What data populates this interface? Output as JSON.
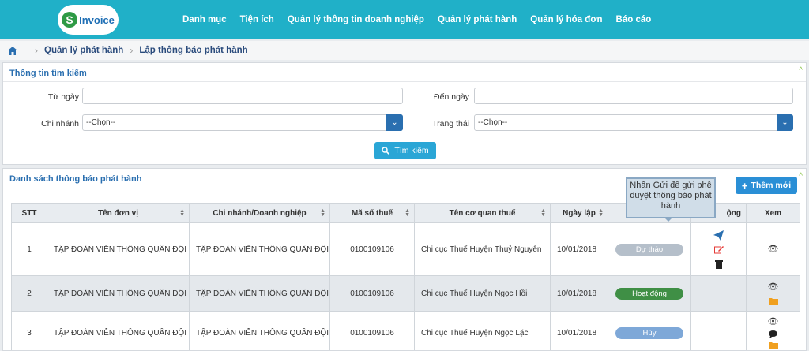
{
  "header": {
    "logo_text": "Invoice",
    "logo_letter": "S",
    "menu": [
      "Danh mục",
      "Tiện ích",
      "Quản lý thông tin doanh nghiệp",
      "Quản lý phát hành",
      "Quản lý hóa đơn",
      "Báo cáo"
    ]
  },
  "breadcrumb": {
    "items": [
      "Quản lý phát hành",
      "Lập thông báo phát hành"
    ]
  },
  "search": {
    "title": "Thông tin tìm kiếm",
    "from_date_label": "Từ ngày",
    "to_date_label": "Đến ngày",
    "branch_label": "Chi nhánh",
    "branch_value": "--Chọn--",
    "status_label": "Trạng thái",
    "status_value": "--Chọn--",
    "search_button": "Tìm kiếm"
  },
  "list": {
    "title": "Danh sách thông báo phát hành",
    "add_button": "Thêm mới",
    "tooltip": "Nhấn Gửi để gửi phê duyệt thông báo phát hành",
    "columns": [
      "STT",
      "Tên đơn vị",
      "Chi nhánh/Doanh nghiệp",
      "Mã số thuế",
      "Tên cơ quan thuế",
      "Ngày lập",
      "",
      "ộng",
      "Xem"
    ],
    "rows": [
      {
        "stt": "1",
        "unit": "TẬP ĐOÀN VIỄN THÔNG QUÂN ĐỘI",
        "branch": "TẬP ĐOÀN VIỄN THÔNG QUÂN ĐỘI",
        "tax": "0100109106",
        "office": "Chi cục Thuế Huyện Thuỷ Nguyên",
        "date": "10/01/2018",
        "status": "Dự thảo"
      },
      {
        "stt": "2",
        "unit": "TẬP ĐOÀN VIỄN THÔNG QUÂN ĐỘI",
        "branch": "TẬP ĐOÀN VIỄN THÔNG QUÂN ĐỘI",
        "tax": "0100109106",
        "office": "Chi cục Thuế Huyện Ngọc Hồi",
        "date": "10/01/2018",
        "status": "Hoạt động"
      },
      {
        "stt": "3",
        "unit": "TẬP ĐOÀN VIỄN THÔNG QUÂN ĐỘI",
        "branch": "TẬP ĐOÀN VIỄN THÔNG QUÂN ĐỘI",
        "tax": "0100109106",
        "office": "Chi cục Thuế Huyện Ngọc Lặc",
        "date": "10/01/2018",
        "status": "Hủy"
      }
    ]
  },
  "colors": {
    "header": "#20b0c8",
    "draft": "#b5bfca",
    "active": "#3f8f45",
    "cancel": "#7ea8d8",
    "send": "#2a6fb0",
    "edit": "#e53935"
  }
}
